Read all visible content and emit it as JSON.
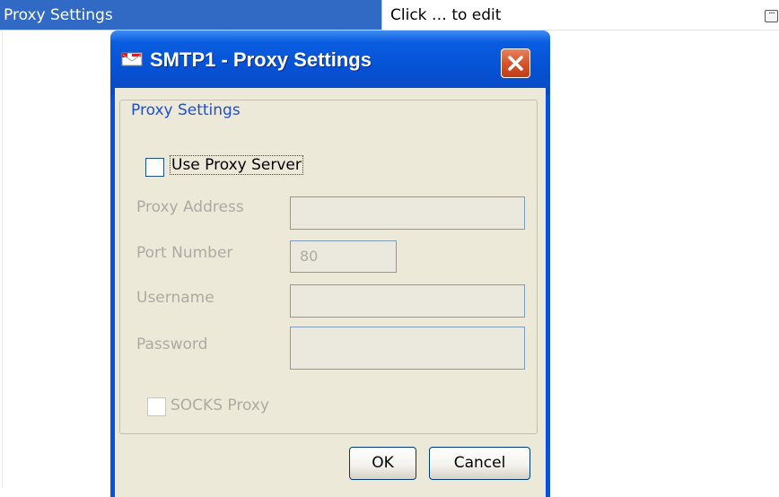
{
  "property_row": {
    "name": "Proxy Settings",
    "value": "Click … to edit",
    "ellipsis": "···"
  },
  "dialog": {
    "title": "SMTP1 - Proxy Settings",
    "icon": "smtp-envelope-icon",
    "close_icon": "close-icon",
    "group_title": "Proxy Settings",
    "use_proxy": {
      "label": "Use Proxy Server",
      "checked": false,
      "enabled": true
    },
    "fields": {
      "proxy_address": {
        "label": "Proxy Address",
        "value": ""
      },
      "port_number": {
        "label": "Port Number",
        "value": "80"
      },
      "username": {
        "label": "Username",
        "value": ""
      },
      "password": {
        "label": "Password",
        "value": ""
      }
    },
    "socks_proxy": {
      "label": "SOCKS Proxy",
      "checked": false,
      "enabled": false
    },
    "buttons": {
      "ok": "OK",
      "cancel": "Cancel"
    }
  },
  "colors": {
    "selection": "#316ac5",
    "titlebar": "#0551d4",
    "dialog_bg": "#ece9d8",
    "group_title": "#2250c8",
    "disabled_text": "#acaba3",
    "close_button": "#d9532a"
  }
}
